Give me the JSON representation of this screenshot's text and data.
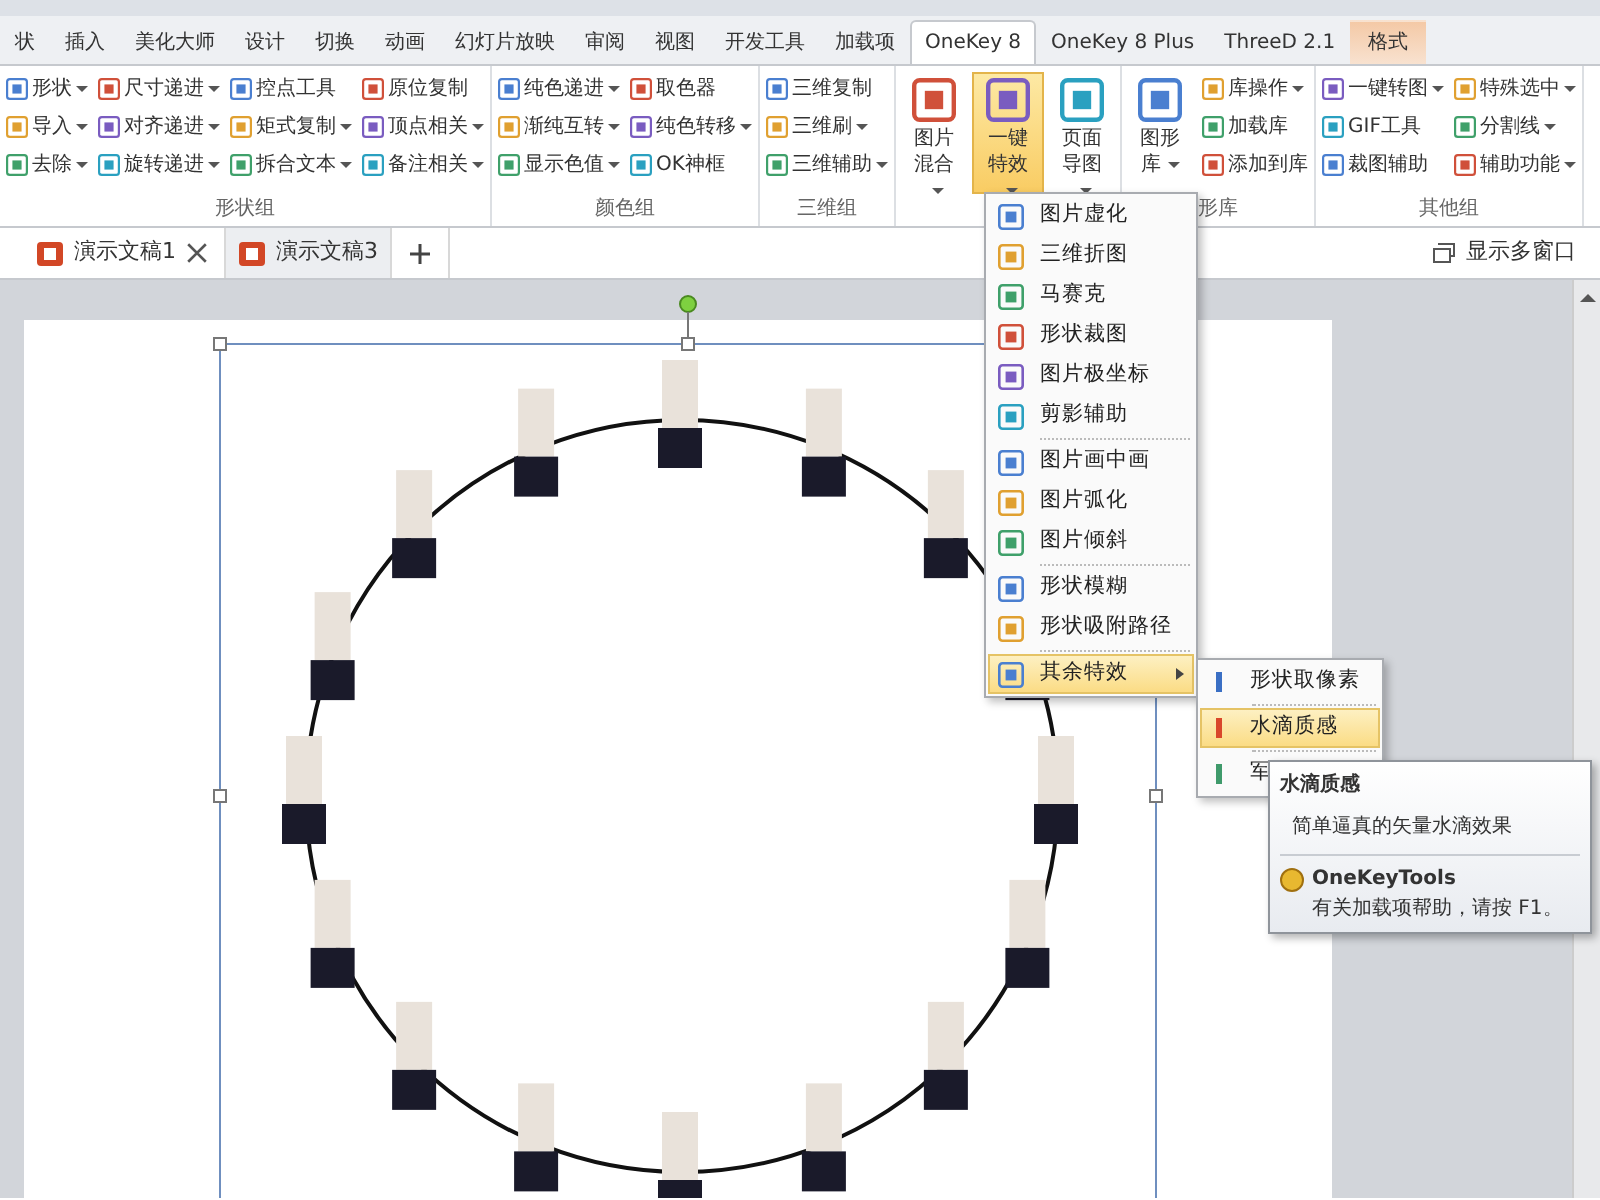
{
  "ribbon_tabs": [
    {
      "label": "状",
      "selected": false,
      "kind": "normal"
    },
    {
      "label": "插入",
      "selected": false,
      "kind": "normal"
    },
    {
      "label": "美化大师",
      "selected": false,
      "kind": "normal"
    },
    {
      "label": "设计",
      "selected": false,
      "kind": "normal"
    },
    {
      "label": "切换",
      "selected": false,
      "kind": "normal"
    },
    {
      "label": "动画",
      "selected": false,
      "kind": "normal"
    },
    {
      "label": "幻灯片放映",
      "selected": false,
      "kind": "normal"
    },
    {
      "label": "审阅",
      "selected": false,
      "kind": "normal"
    },
    {
      "label": "视图",
      "selected": false,
      "kind": "normal"
    },
    {
      "label": "开发工具",
      "selected": false,
      "kind": "normal"
    },
    {
      "label": "加载项",
      "selected": false,
      "kind": "normal"
    },
    {
      "label": "OneKey 8",
      "selected": true,
      "kind": "normal"
    },
    {
      "label": "OneKey 8 Plus",
      "selected": false,
      "kind": "normal"
    },
    {
      "label": "ThreeD 2.1",
      "selected": false,
      "kind": "normal"
    },
    {
      "label": "格式",
      "selected": false,
      "kind": "contextual"
    }
  ],
  "ribbon_groups": [
    {
      "label": "形状组",
      "columns": [
        [
          {
            "label": "形状",
            "kind": "small",
            "dropdown": true
          },
          {
            "label": "导入",
            "kind": "small",
            "dropdown": true
          },
          {
            "label": "去除",
            "kind": "small",
            "dropdown": true
          }
        ],
        [
          {
            "label": "尺寸递进",
            "kind": "small",
            "dropdown": true
          },
          {
            "label": "对齐递进",
            "kind": "small",
            "dropdown": true
          },
          {
            "label": "旋转递进",
            "kind": "small",
            "dropdown": true
          }
        ],
        [
          {
            "label": "控点工具",
            "kind": "small",
            "dropdown": false
          },
          {
            "label": "矩式复制",
            "kind": "small",
            "dropdown": true
          },
          {
            "label": "拆合文本",
            "kind": "small",
            "dropdown": true
          }
        ],
        [
          {
            "label": "原位复制",
            "kind": "small",
            "dropdown": false
          },
          {
            "label": "顶点相关",
            "kind": "small",
            "dropdown": true
          },
          {
            "label": "备注相关",
            "kind": "small",
            "dropdown": true
          }
        ]
      ]
    },
    {
      "label": "颜色组",
      "columns": [
        [
          {
            "label": "纯色递进",
            "kind": "small",
            "dropdown": true
          },
          {
            "label": "渐纯互转",
            "kind": "small",
            "dropdown": true
          },
          {
            "label": "显示色值",
            "kind": "small",
            "dropdown": true
          }
        ],
        [
          {
            "label": "取色器",
            "kind": "small",
            "dropdown": false
          },
          {
            "label": "纯色转移",
            "kind": "small",
            "dropdown": true
          },
          {
            "label": "OK神框",
            "kind": "small",
            "dropdown": false
          }
        ]
      ]
    },
    {
      "label": "三维组",
      "columns": [
        [
          {
            "label": "三维复制",
            "kind": "small",
            "dropdown": false
          },
          {
            "label": "三维刷",
            "kind": "small",
            "dropdown": true
          },
          {
            "label": "三维辅助",
            "kind": "small",
            "dropdown": true
          }
        ]
      ]
    },
    {
      "columns": [
        [
          {
            "label": "图片混合",
            "kind": "large",
            "dropdown": true,
            "active": false
          }
        ],
        [
          {
            "label": "一键特效",
            "kind": "large",
            "dropdown": true,
            "active": true
          }
        ],
        [
          {
            "label": "页面导图",
            "kind": "large",
            "dropdown": true,
            "active": false
          }
        ]
      ]
    },
    {
      "label": "形库",
      "columns": [
        [
          {
            "label": "图形库",
            "kind": "large",
            "dropdown": true,
            "active": false
          }
        ],
        [
          {
            "label": "库操作",
            "kind": "small",
            "dropdown": true
          },
          {
            "label": "加载库",
            "kind": "small",
            "dropdown": false
          },
          {
            "label": "添加到库",
            "kind": "small",
            "dropdown": false
          }
        ]
      ]
    },
    {
      "label": "其他组",
      "columns": [
        [
          {
            "label": "一键转图",
            "kind": "small",
            "dropdown": true
          },
          {
            "label": "GIF工具",
            "kind": "small",
            "dropdown": false
          },
          {
            "label": "裁图辅助",
            "kind": "small",
            "dropdown": false
          }
        ],
        [
          {
            "label": "特殊选中",
            "kind": "small",
            "dropdown": true
          },
          {
            "label": "分割线",
            "kind": "small",
            "dropdown": true
          },
          {
            "label": "辅助功能",
            "kind": "small",
            "dropdown": true
          }
        ]
      ]
    }
  ],
  "document_tabs": [
    {
      "label": "演示文稿1",
      "selected": true,
      "closable": true
    },
    {
      "label": "演示文稿3",
      "selected": false,
      "closable": false
    }
  ],
  "show_multiple_windows": "显示多窗口",
  "effects_menu": {
    "sections": [
      [
        {
          "label": "图片虚化",
          "highlighted": false,
          "has_submenu": false
        },
        {
          "label": "三维折图",
          "highlighted": false,
          "has_submenu": false
        },
        {
          "label": "马赛克",
          "highlighted": false,
          "has_submenu": false
        },
        {
          "label": "形状裁图",
          "highlighted": false,
          "has_submenu": false
        },
        {
          "label": "图片极坐标",
          "highlighted": false,
          "has_submenu": false
        },
        {
          "label": "剪影辅助",
          "highlighted": false,
          "has_submenu": false
        }
      ],
      [
        {
          "label": "图片画中画",
          "highlighted": false,
          "has_submenu": false
        },
        {
          "label": "图片弧化",
          "highlighted": false,
          "has_submenu": false
        },
        {
          "label": "图片倾斜",
          "highlighted": false,
          "has_submenu": false
        }
      ],
      [
        {
          "label": "形状模糊",
          "highlighted": false,
          "has_submenu": false
        },
        {
          "label": "形状吸附路径",
          "highlighted": false,
          "has_submenu": false
        }
      ],
      [
        {
          "label": "其余特效",
          "highlighted": true,
          "has_submenu": true
        }
      ]
    ]
  },
  "submenu": [
    {
      "label": "形状取像素",
      "color": "#3a6fc4",
      "highlighted": false
    },
    {
      "label": "水滴质感",
      "color": "#d9472b",
      "highlighted": true
    },
    {
      "label": "军",
      "color": "#3f9a6b",
      "highlighted": false
    }
  ],
  "tooltip": {
    "title": "水滴质感",
    "description": "简单逼真的矢量水滴效果",
    "footer_title": "OneKeyTools",
    "footer_text": "有关加载项帮助，请按 F1。"
  }
}
